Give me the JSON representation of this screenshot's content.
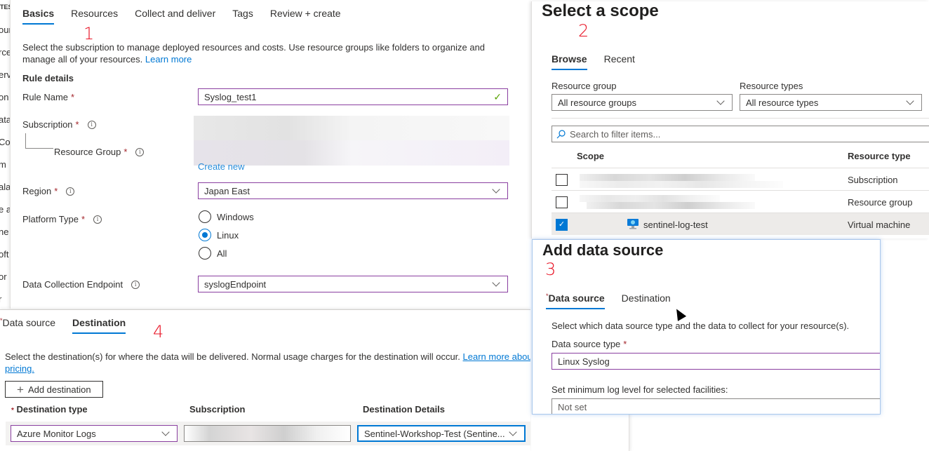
{
  "sidebar_fragments": [
    "TES",
    "our",
    "rce",
    "erv",
    "on",
    "ata",
    "Co",
    "m",
    "ala",
    "e a",
    "ne",
    "oft",
    "or",
    "r"
  ],
  "annotations": {
    "one": "1",
    "two": "2",
    "three": "3",
    "four": "4"
  },
  "basics": {
    "tabs": [
      {
        "label": "Basics",
        "active": true
      },
      {
        "label": "Resources",
        "active": false
      },
      {
        "label": "Collect and deliver",
        "active": false
      },
      {
        "label": "Tags",
        "active": false
      },
      {
        "label": "Review + create",
        "active": false
      }
    ],
    "description": "Select the subscription to manage deployed resources and costs. Use resource groups like folders to organize and manage all of your resources.",
    "learn_more": "Learn more",
    "section_title": "Rule details",
    "rule_name_label": "Rule Name",
    "rule_name_value": "Syslog_test1",
    "subscription_label": "Subscription",
    "resource_group_label": "Resource Group",
    "create_new": "Create new",
    "region_label": "Region",
    "region_value": "Japan East",
    "platform_label": "Platform Type",
    "platform_options": [
      {
        "label": "Windows",
        "selected": false
      },
      {
        "label": "Linux",
        "selected": true
      },
      {
        "label": "All",
        "selected": false
      }
    ],
    "dce_label": "Data Collection Endpoint",
    "dce_value": "syslogEndpoint",
    "required_mark": "*",
    "info_icon": "i"
  },
  "scope": {
    "title": "Select a scope",
    "tabs": [
      {
        "label": "Browse",
        "active": true
      },
      {
        "label": "Recent",
        "active": false
      }
    ],
    "resource_group_label": "Resource group",
    "resource_group_value": "All resource groups",
    "resource_types_label": "Resource types",
    "resource_types_value": "All resource types",
    "search_placeholder": "Search to filter items...",
    "columns": {
      "scope": "Scope",
      "resource_type": "Resource type"
    },
    "rows": [
      {
        "scope": "",
        "resource_type": "Subscription",
        "checked": false
      },
      {
        "scope": "",
        "resource_type": "Resource group",
        "checked": false
      },
      {
        "scope": "sentinel-log-test",
        "resource_type": "Virtual machine",
        "checked": true
      }
    ]
  },
  "add_data_source": {
    "title": "Add data source",
    "tabs": [
      {
        "label": "Data source",
        "active": true,
        "required": true
      },
      {
        "label": "Destination",
        "active": false,
        "required": false
      }
    ],
    "description": "Select which data source type and the data to collect for your resource(s).",
    "type_label": "Data source type",
    "type_value": "Linux Syslog",
    "log_level_label": "Set minimum log level for selected facilities:",
    "log_level_value": "Not set"
  },
  "destination": {
    "tabs": [
      {
        "label": "Data source",
        "active": false,
        "required": true
      },
      {
        "label": "Destination",
        "active": true,
        "required": false
      }
    ],
    "description": "Select the destination(s) for where the data will be delivered. Normal usage charges for the destination will occur.",
    "learn_more": "Learn more about",
    "pricing": "pricing.",
    "add_button": "Add destination",
    "columns": {
      "type": "Destination type",
      "subscription": "Subscription",
      "details": "Destination Details"
    },
    "row": {
      "type": "Azure Monitor Logs",
      "subscription": "",
      "details": "Sentinel-Workshop-Test (Sentine..."
    }
  },
  "colors": {
    "accent": "#0078d4",
    "focus_border": "#8a3fa0",
    "required": "#a4262c",
    "annotation": "#e81123",
    "valid": "#57a300"
  }
}
